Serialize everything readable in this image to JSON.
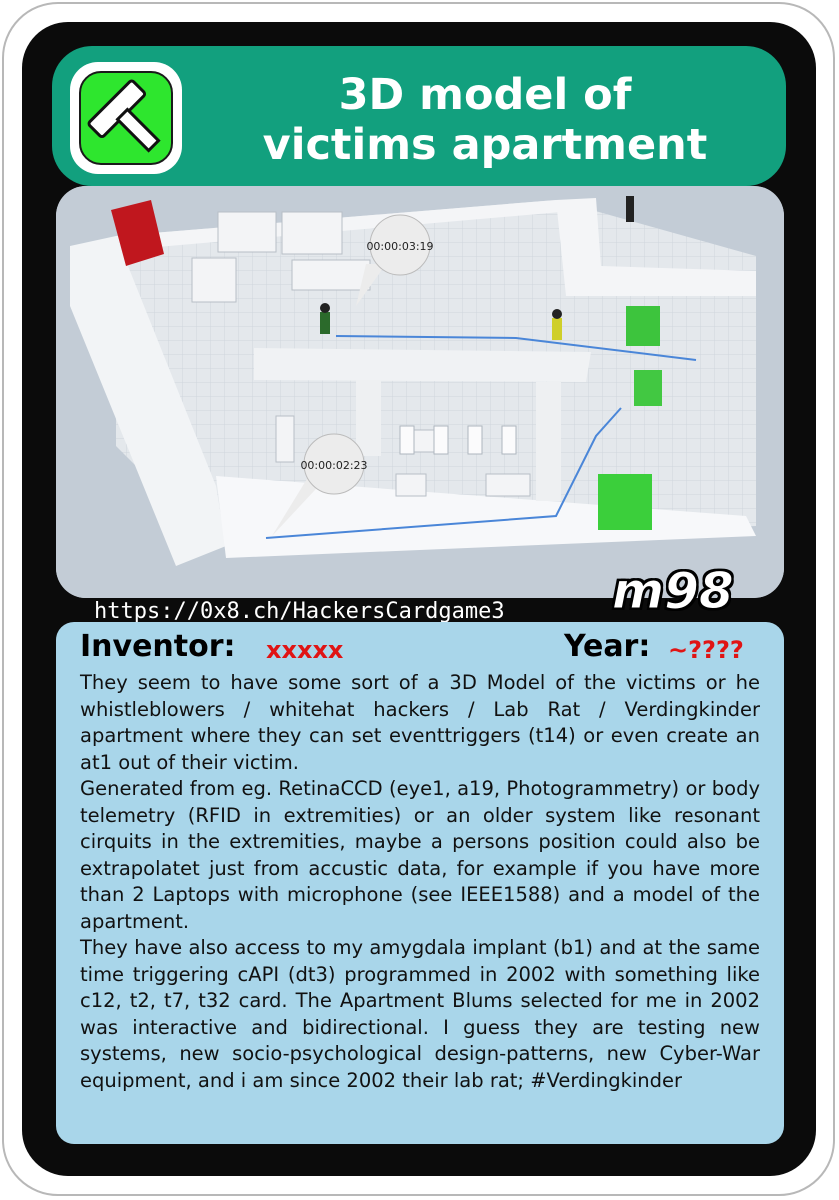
{
  "card": {
    "title_line1": "3D model of",
    "title_line2": "victims apartment",
    "icon": "hammer-icon",
    "id_code": "m98",
    "url": "https://0x8.ch/HackersCardgame3",
    "colors": {
      "title_bar": "#12a07e",
      "icon_bg": "#2ee62e",
      "text_panel": "#a9d6ea",
      "highlight": "#e01414"
    }
  },
  "image": {
    "timestamp_1": "00:00:03:19",
    "timestamp_2": "00:00:02:23"
  },
  "meta": {
    "inventor_label": "Inventor:",
    "inventor_value": "xxxxx",
    "year_label": "Year:",
    "year_value": "~????"
  },
  "description": {
    "para1": "They seem to have some sort of a 3D Model of the victims or he whistleblowers / whitehat hackers / Lab Rat / Verdingkinder apartment where they can set eventtriggers (t14) or even create an at1 out of their victim.",
    "para2": "Generated from eg. RetinaCCD (eye1, a19, Photogrammetry) or body telemetry (RFID in extremities) or an older system like resonant cirquits in the extremities, maybe a persons position could also be extrapolatet just from accustic data, for example if you have more than 2 Laptops with microphone (see IEEE1588) and a model of the apartment.",
    "para3": "They have also access to my amygdala implant (b1) and at the same time triggering cAPI (dt3) programmed in 2002 with something like c12, t2, t7, t32 card. The Apartment Blums selected for me in 2002 was interactive and bidirectional. I guess they are testing new systems, new socio-psychological design-patterns, new Cyber-War equipment, and i am since 2002 their lab rat; #Verdingkinder"
  }
}
